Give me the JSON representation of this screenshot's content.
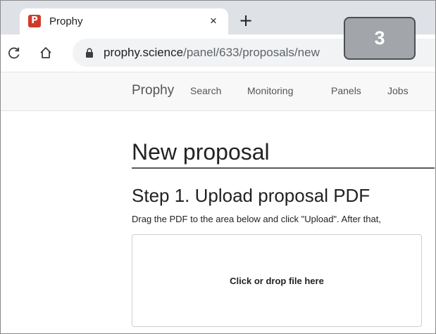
{
  "browser": {
    "tab": {
      "favicon_letter": "P",
      "title": "Prophy",
      "close_glyph": "×"
    },
    "new_tab_glyph": "+",
    "url": {
      "host": "prophy.science",
      "path": "/panel/633/proposals/new"
    }
  },
  "overlay": {
    "step_number": "3"
  },
  "site_nav": {
    "brand": "Prophy",
    "links": [
      "Search",
      "Monitoring",
      "Panels",
      "Jobs"
    ]
  },
  "main": {
    "title": "New proposal",
    "step_title": "Step 1. Upload proposal PDF",
    "step_description": "Drag the PDF to the area below and click \"Upload\". After that,",
    "dropzone_label": "Click or drop file here"
  },
  "colors": {
    "favicon": "#cf3b2a",
    "badge": "#a2a5aa",
    "nav_bg": "#f8f8f8"
  }
}
